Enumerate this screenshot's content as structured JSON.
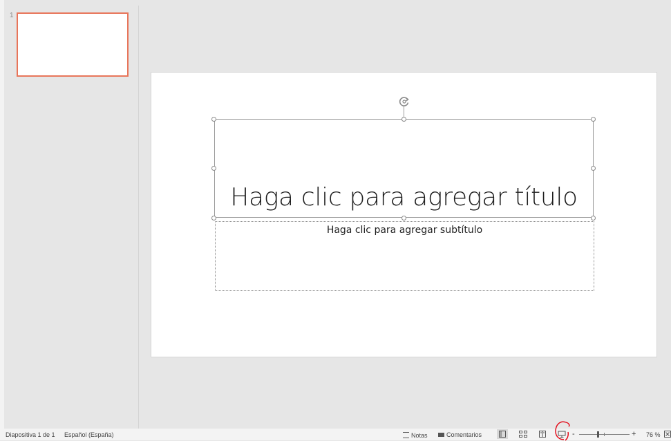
{
  "thumbnail_pane": {
    "slide_number": "1"
  },
  "slide": {
    "title_placeholder": "Haga clic para agregar título",
    "subtitle_placeholder": "Haga clic para agregar subtítulo"
  },
  "status_bar": {
    "slide_info": "Diapositiva 1 de 1",
    "language": "Español (España)",
    "notes_label": "Notas",
    "comments_label": "Comentarios",
    "zoom_level": "76 %",
    "zoom_minus": "-",
    "zoom_plus": "+"
  },
  "colors": {
    "selected_thumb_border": "#e8755a",
    "workspace_bg": "#e6e6e6",
    "annotation_red": "#e3000f"
  },
  "icons": [
    "rotate-icon",
    "notes-icon",
    "comments-icon",
    "normal-view-icon",
    "slide-sorter-icon",
    "reading-view-icon",
    "slideshow-icon",
    "fit-to-window-icon"
  ]
}
